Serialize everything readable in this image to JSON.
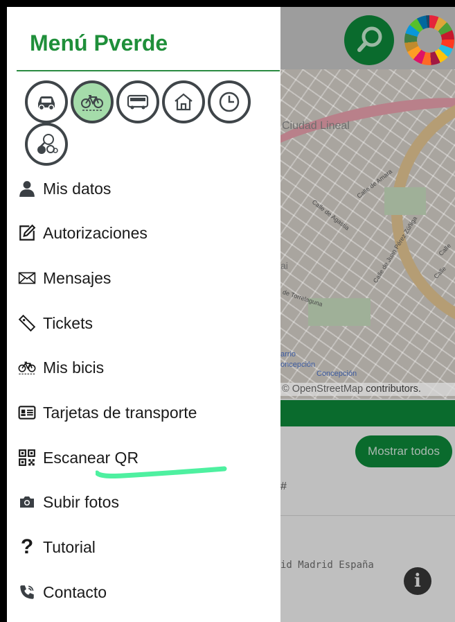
{
  "drawer": {
    "title": "Menú Pverde",
    "filters": [
      {
        "name": "car-filter-icon",
        "active": false
      },
      {
        "name": "bicycle-filter-icon",
        "active": true
      },
      {
        "name": "bus-filter-icon",
        "active": false
      },
      {
        "name": "home-filter-icon",
        "active": false
      },
      {
        "name": "clock-filter-icon",
        "active": false
      },
      {
        "name": "sports-filter-icon",
        "active": false
      }
    ],
    "menu": [
      {
        "label": "Mis datos",
        "icon": "user-icon"
      },
      {
        "label": "Autorizaciones",
        "icon": "edit-icon"
      },
      {
        "label": "Mensajes",
        "icon": "envelope-icon"
      },
      {
        "label": "Tickets",
        "icon": "ticket-icon"
      },
      {
        "label": "Mis bicis",
        "icon": "bicycle-icon"
      },
      {
        "label": "Tarjetas de transporte",
        "icon": "id-card-icon"
      },
      {
        "label": "Escanear QR",
        "icon": "qr-code-icon"
      },
      {
        "label": "Subir fotos",
        "icon": "camera-icon"
      },
      {
        "label": "Tutorial",
        "icon": "question-icon"
      },
      {
        "label": "Contacto",
        "icon": "phone-icon"
      }
    ]
  },
  "background": {
    "map_labels": {
      "district": "Ciudad Lineal",
      "street1": "Calle de Amara",
      "street2": "Calle de Agastia",
      "street3": "Calle de Juan Pérez Zúñiga",
      "street4": "de Torrelaguna",
      "street5": "Calle",
      "street6": "Calle",
      "barrio": "arrio",
      "concepcion1": "oncepción",
      "concepcion2": "Concepción",
      "ai": "ai"
    },
    "attribution_osm": "© OpenStreetMap",
    "attribution_contrib": "contributors.",
    "show_all_label": "Mostrar todos",
    "hash_text": "#",
    "address_text": "id Madrid España",
    "colors": {
      "brand_green": "#1f8f3a",
      "dark_green": "#0a6b2d",
      "active_filter": "#a5dcaa",
      "highlight_underline": "#4ef0a0"
    }
  }
}
